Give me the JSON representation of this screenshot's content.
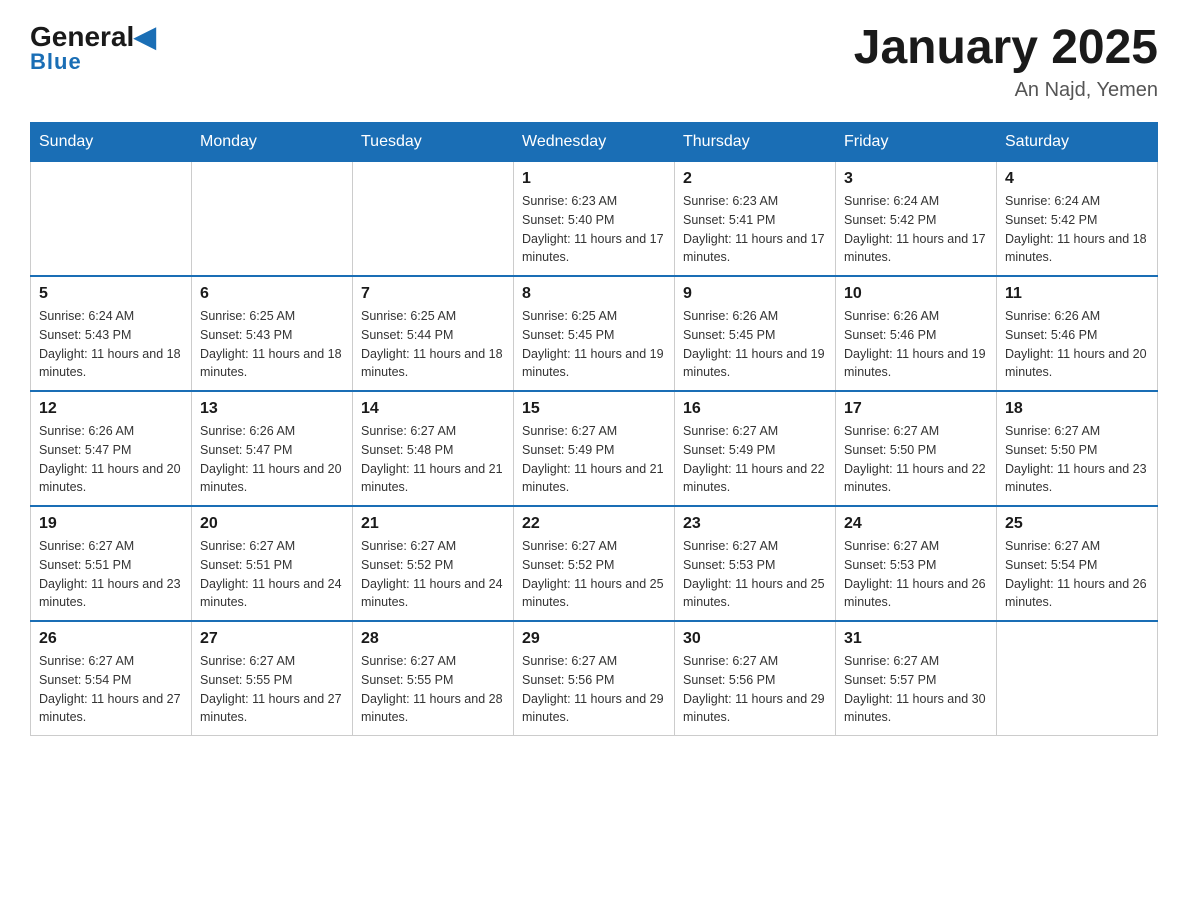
{
  "header": {
    "logo": {
      "general": "General",
      "blue": "Blue",
      "triangle": "▲"
    },
    "title": "January 2025",
    "subtitle": "An Najd, Yemen"
  },
  "days_of_week": [
    "Sunday",
    "Monday",
    "Tuesday",
    "Wednesday",
    "Thursday",
    "Friday",
    "Saturday"
  ],
  "weeks": [
    [
      {
        "day": "",
        "info": ""
      },
      {
        "day": "",
        "info": ""
      },
      {
        "day": "",
        "info": ""
      },
      {
        "day": "1",
        "info": "Sunrise: 6:23 AM\nSunset: 5:40 PM\nDaylight: 11 hours and 17 minutes."
      },
      {
        "day": "2",
        "info": "Sunrise: 6:23 AM\nSunset: 5:41 PM\nDaylight: 11 hours and 17 minutes."
      },
      {
        "day": "3",
        "info": "Sunrise: 6:24 AM\nSunset: 5:42 PM\nDaylight: 11 hours and 17 minutes."
      },
      {
        "day": "4",
        "info": "Sunrise: 6:24 AM\nSunset: 5:42 PM\nDaylight: 11 hours and 18 minutes."
      }
    ],
    [
      {
        "day": "5",
        "info": "Sunrise: 6:24 AM\nSunset: 5:43 PM\nDaylight: 11 hours and 18 minutes."
      },
      {
        "day": "6",
        "info": "Sunrise: 6:25 AM\nSunset: 5:43 PM\nDaylight: 11 hours and 18 minutes."
      },
      {
        "day": "7",
        "info": "Sunrise: 6:25 AM\nSunset: 5:44 PM\nDaylight: 11 hours and 18 minutes."
      },
      {
        "day": "8",
        "info": "Sunrise: 6:25 AM\nSunset: 5:45 PM\nDaylight: 11 hours and 19 minutes."
      },
      {
        "day": "9",
        "info": "Sunrise: 6:26 AM\nSunset: 5:45 PM\nDaylight: 11 hours and 19 minutes."
      },
      {
        "day": "10",
        "info": "Sunrise: 6:26 AM\nSunset: 5:46 PM\nDaylight: 11 hours and 19 minutes."
      },
      {
        "day": "11",
        "info": "Sunrise: 6:26 AM\nSunset: 5:46 PM\nDaylight: 11 hours and 20 minutes."
      }
    ],
    [
      {
        "day": "12",
        "info": "Sunrise: 6:26 AM\nSunset: 5:47 PM\nDaylight: 11 hours and 20 minutes."
      },
      {
        "day": "13",
        "info": "Sunrise: 6:26 AM\nSunset: 5:47 PM\nDaylight: 11 hours and 20 minutes."
      },
      {
        "day": "14",
        "info": "Sunrise: 6:27 AM\nSunset: 5:48 PM\nDaylight: 11 hours and 21 minutes."
      },
      {
        "day": "15",
        "info": "Sunrise: 6:27 AM\nSunset: 5:49 PM\nDaylight: 11 hours and 21 minutes."
      },
      {
        "day": "16",
        "info": "Sunrise: 6:27 AM\nSunset: 5:49 PM\nDaylight: 11 hours and 22 minutes."
      },
      {
        "day": "17",
        "info": "Sunrise: 6:27 AM\nSunset: 5:50 PM\nDaylight: 11 hours and 22 minutes."
      },
      {
        "day": "18",
        "info": "Sunrise: 6:27 AM\nSunset: 5:50 PM\nDaylight: 11 hours and 23 minutes."
      }
    ],
    [
      {
        "day": "19",
        "info": "Sunrise: 6:27 AM\nSunset: 5:51 PM\nDaylight: 11 hours and 23 minutes."
      },
      {
        "day": "20",
        "info": "Sunrise: 6:27 AM\nSunset: 5:51 PM\nDaylight: 11 hours and 24 minutes."
      },
      {
        "day": "21",
        "info": "Sunrise: 6:27 AM\nSunset: 5:52 PM\nDaylight: 11 hours and 24 minutes."
      },
      {
        "day": "22",
        "info": "Sunrise: 6:27 AM\nSunset: 5:52 PM\nDaylight: 11 hours and 25 minutes."
      },
      {
        "day": "23",
        "info": "Sunrise: 6:27 AM\nSunset: 5:53 PM\nDaylight: 11 hours and 25 minutes."
      },
      {
        "day": "24",
        "info": "Sunrise: 6:27 AM\nSunset: 5:53 PM\nDaylight: 11 hours and 26 minutes."
      },
      {
        "day": "25",
        "info": "Sunrise: 6:27 AM\nSunset: 5:54 PM\nDaylight: 11 hours and 26 minutes."
      }
    ],
    [
      {
        "day": "26",
        "info": "Sunrise: 6:27 AM\nSunset: 5:54 PM\nDaylight: 11 hours and 27 minutes."
      },
      {
        "day": "27",
        "info": "Sunrise: 6:27 AM\nSunset: 5:55 PM\nDaylight: 11 hours and 27 minutes."
      },
      {
        "day": "28",
        "info": "Sunrise: 6:27 AM\nSunset: 5:55 PM\nDaylight: 11 hours and 28 minutes."
      },
      {
        "day": "29",
        "info": "Sunrise: 6:27 AM\nSunset: 5:56 PM\nDaylight: 11 hours and 29 minutes."
      },
      {
        "day": "30",
        "info": "Sunrise: 6:27 AM\nSunset: 5:56 PM\nDaylight: 11 hours and 29 minutes."
      },
      {
        "day": "31",
        "info": "Sunrise: 6:27 AM\nSunset: 5:57 PM\nDaylight: 11 hours and 30 minutes."
      },
      {
        "day": "",
        "info": ""
      }
    ]
  ]
}
